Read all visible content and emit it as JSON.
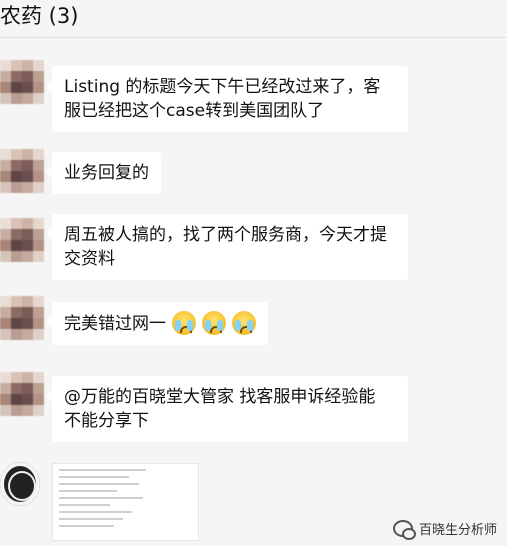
{
  "header": {
    "title": "农药 (3)"
  },
  "messages": [
    {
      "lines": [
        "Listing 的标题今天下午已经改过来了，客",
        "服已经把这个case转到美国团队了"
      ]
    },
    {
      "lines": [
        "业务回复的"
      ]
    },
    {
      "lines": [
        "周五被人搞的，找了两个服务商，今天才提",
        "交资料"
      ]
    },
    {
      "text": "完美错过网一",
      "emojis": [
        "crying-face",
        "crying-face",
        "crying-face"
      ]
    },
    {
      "lines": [
        "@万能的百晓堂大管家 找客服申诉经验能",
        "不能分享下"
      ]
    }
  ],
  "watermark": {
    "text": "百晓生分析师",
    "icon": "wechat-icon"
  }
}
